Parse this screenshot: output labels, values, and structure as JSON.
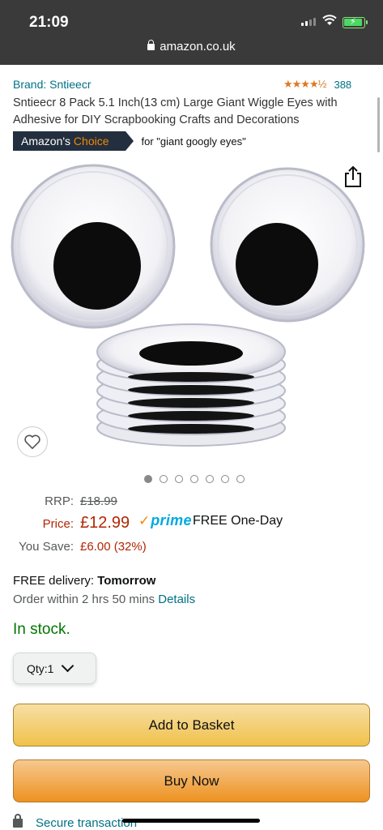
{
  "status_bar": {
    "time": "21:09"
  },
  "browser": {
    "url": "amazon.co.uk"
  },
  "product": {
    "brand": "Brand: Sntieecr",
    "rating_stars": "★★★★½",
    "rating_value": 4.5,
    "rating_count": "388",
    "title": "Sntieecr 8 Pack 5.1 Inch(13 cm) Large Giant Wiggle Eyes with Adhesive for DIY Scrapbooking Crafts and Decorations",
    "choice_badge_prefix": "Amazon's ",
    "choice_badge_highlight": "Choice",
    "choice_for": "for \"giant googly eyes\"",
    "image_count": 7,
    "image_active_index": 0
  },
  "pricing": {
    "rrp_label": "RRP:",
    "rrp_value": "£18.99",
    "price_label": "Price:",
    "price_value": "£12.99",
    "prime_label": "prime",
    "prime_check": "✓",
    "prime_delivery": "FREE One-Day",
    "save_label": "You Save:",
    "save_value": "£6.00 (32%)"
  },
  "delivery": {
    "prefix": "FREE delivery: ",
    "day": "Tomorrow",
    "order_within": "Order within 2 hrs 50 mins ",
    "details_link": "Details"
  },
  "stock": {
    "status": "In stock."
  },
  "quantity": {
    "label": "Qty: ",
    "value": "1"
  },
  "buttons": {
    "add_to_basket": "Add to Basket",
    "buy_now": "Buy Now"
  },
  "secure": {
    "label": "Secure transaction"
  },
  "colors": {
    "link": "#007185",
    "price": "#B12704",
    "in_stock": "#007600",
    "badge_bg": "#232f3e",
    "badge_accent": "#f08804",
    "prime_blue": "#00a8e1",
    "basket_yellow": "#f0c14b",
    "buy_orange": "#ed9220"
  },
  "icons": {
    "share": "share-icon",
    "wishlist": "heart-icon",
    "lock": "lock-icon",
    "chevron": "chevron-down-icon"
  }
}
